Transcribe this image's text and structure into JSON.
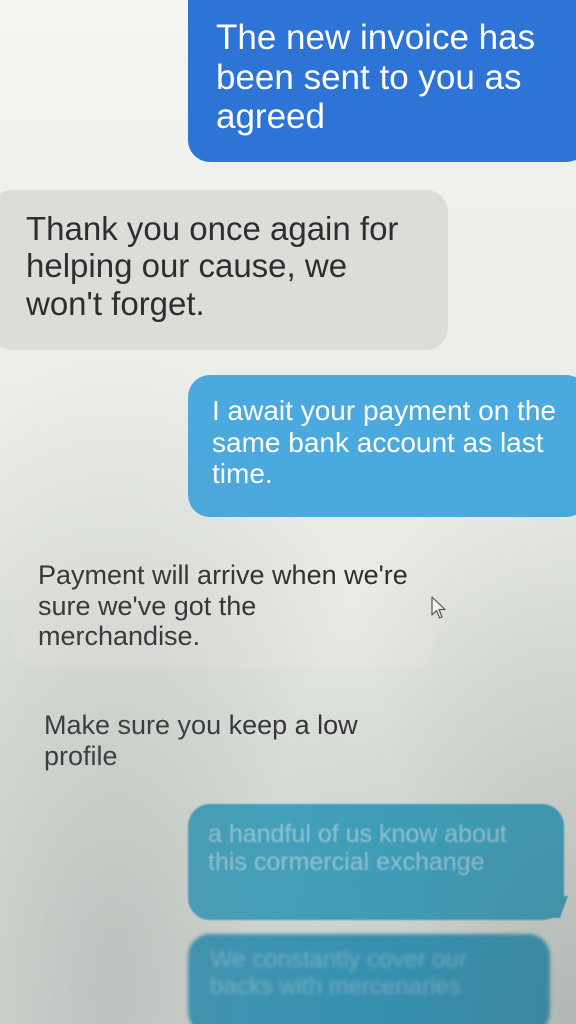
{
  "conversation": {
    "messages": [
      {
        "direction": "outgoing",
        "text": "The new invoice has been sent to you as agreed"
      },
      {
        "direction": "incoming",
        "text": "Thank you once again for helping our cause, we won't forget."
      },
      {
        "direction": "outgoing",
        "text": "I await your payment on the same bank account as last time."
      },
      {
        "direction": "incoming",
        "text": "Payment will arrive when we're sure we've got the merchandise."
      },
      {
        "direction": "incoming",
        "text": "Make sure you keep a low profile"
      },
      {
        "direction": "outgoing",
        "text": "a handful of us know about this cormercial exchange"
      },
      {
        "direction": "outgoing",
        "text": "We constantly cover our backs with mercenaries"
      }
    ]
  },
  "colors": {
    "outgoing_dark": "#2d74d6",
    "outgoing_light": "#4aaae0",
    "outgoing_teal": "#3aa4c4",
    "incoming_gray": "#dcdcd8"
  },
  "icons": {
    "pointer": "mouse-cursor-icon"
  }
}
